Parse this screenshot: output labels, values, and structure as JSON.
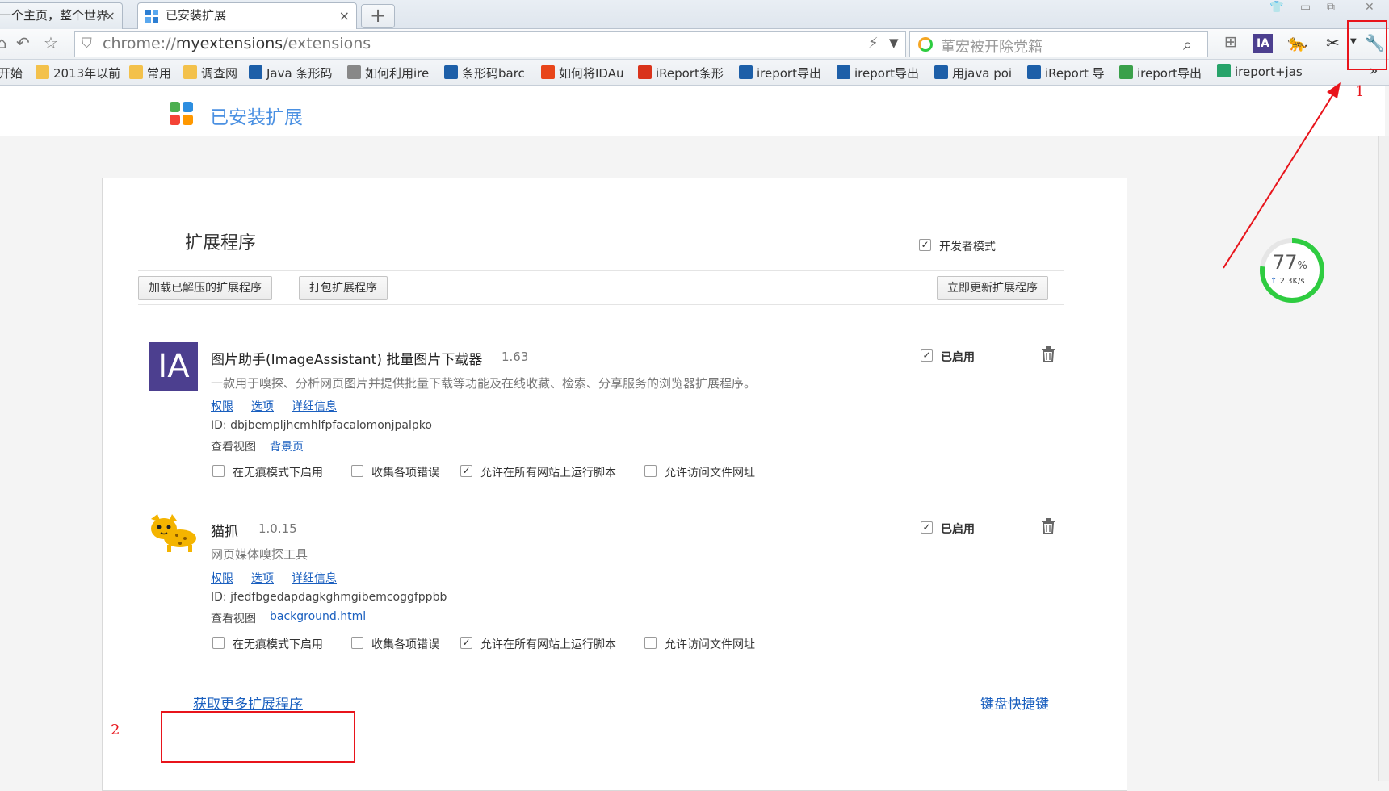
{
  "tabs": [
    {
      "title": "一个主页，整个世界",
      "close": "×"
    },
    {
      "title": "已安装扩展",
      "close": "×"
    }
  ],
  "new_tab_label": "+",
  "address": {
    "prefix": "chrome://",
    "host": "myextensions",
    "path": "/extensions"
  },
  "search": {
    "text": "董宏被开除党籍"
  },
  "toolbar_ia": "IA",
  "bookmarks": [
    "开始",
    "2013年以前",
    "常用",
    "调查网",
    "Java 条形码",
    "如何利用ire",
    "条形码barc",
    "如何将IDAu",
    "iReport条形",
    "ireport导出",
    "ireport导出",
    "用java poi",
    "iReport 导",
    "ireport导出",
    "ireport+jas"
  ],
  "bookmark_more": "»",
  "page_header": {
    "title": "已安装扩展"
  },
  "section": {
    "title": "扩展程序",
    "dev_mode_label": "开发者模式"
  },
  "buttons": {
    "load_unpacked": "加载已解压的扩展程序",
    "pack": "打包扩展程序",
    "update_now": "立即更新扩展程序"
  },
  "extensions": [
    {
      "icon_text": "IA",
      "name": "图片助手(ImageAssistant) 批量图片下载器",
      "version": "1.63",
      "description": "一款用于嗅探、分析网页图片并提供批量下载等功能及在线收藏、检索、分享服务的浏览器扩展程序。",
      "links": [
        "权限",
        "选项",
        "详细信息"
      ],
      "id_text": "ID: dbjbempljhcmhlfpfacalomonjpalpko",
      "views_label": "查看视图",
      "view_link": "背景页",
      "enabled_label": "已启用",
      "options": [
        "在无痕模式下启用",
        "收集各项错误",
        "允许在所有网站上运行脚本",
        "允许访问文件网址"
      ]
    },
    {
      "icon_text": "",
      "name": "猫抓",
      "version": "1.0.15",
      "description": "网页媒体嗅探工具",
      "links": [
        "权限",
        "选项",
        "详细信息"
      ],
      "id_text": "ID: jfedfbgedapdagkghmgibemcoggfppbb",
      "views_label": "查看视图",
      "view_link": "background.html",
      "enabled_label": "已启用",
      "options": [
        "在无痕模式下启用",
        "收集各项错误",
        "允许在所有网站上运行脚本",
        "允许访问文件网址"
      ]
    }
  ],
  "footer": {
    "get_more": "获取更多扩展程序",
    "shortcuts": "键盘快捷键"
  },
  "annotations": {
    "label1": "1",
    "label2": "2"
  },
  "speed_widget": {
    "percent": "77",
    "percent_sign": "%",
    "speed": "2.3K/s"
  },
  "colors": {
    "link": "#1a5fbf",
    "annotation": "#e8141b",
    "gauge": "#2ecc40",
    "ia_bg": "#4c3f8f"
  }
}
